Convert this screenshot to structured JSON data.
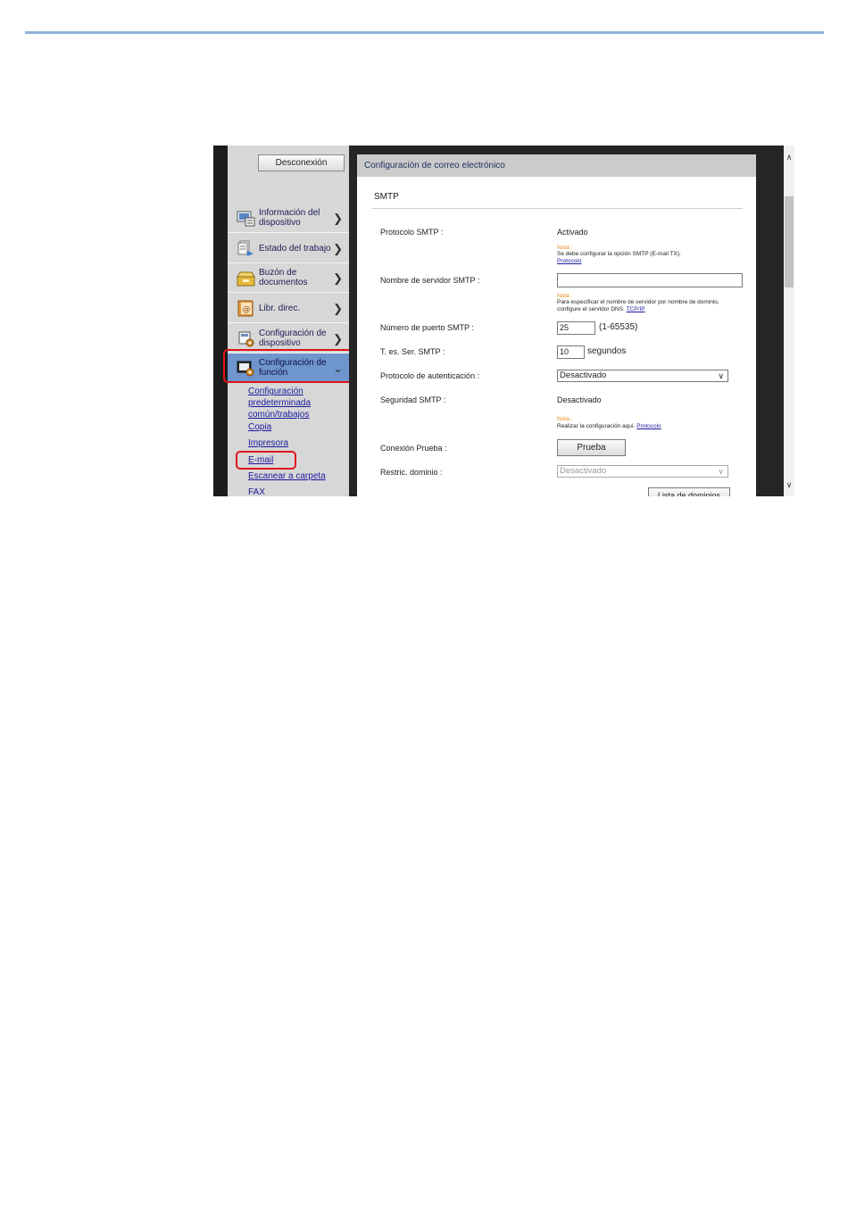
{
  "sidebar": {
    "logout_label": "Desconexión",
    "items": [
      {
        "label_l1": "Información del",
        "label_l2": "dispositivo"
      },
      {
        "label": "Estado del trabajo"
      },
      {
        "label_l1": "Buzón de",
        "label_l2": "documentos"
      },
      {
        "label": "Libr. direc."
      },
      {
        "label_l1": "Configuración de",
        "label_l2": "dispositivo"
      },
      {
        "label_l1": "Configuración de",
        "label_l2": "función"
      }
    ],
    "sublinks": [
      {
        "label_l1": "Configuración",
        "label_l2": "predeterminada",
        "label_l3": "común/trabajos"
      },
      {
        "label": "Copia"
      },
      {
        "label": "Impresora"
      },
      {
        "label": "E-mail"
      },
      {
        "label": "Escanear a carpeta"
      },
      {
        "label": "FAX"
      }
    ]
  },
  "panel": {
    "header": "Configuración de correo electrónico",
    "section_title": "SMTP",
    "smtp_protocol": {
      "label": "Protocolo SMTP :",
      "value": "Activado",
      "note_title": "Nota :",
      "note_text": "Se debe configurar la opción SMTP (E-mail TX).",
      "note_link": "Protocolo"
    },
    "smtp_server": {
      "label": "Nombre de servidor SMTP :",
      "value": "",
      "note_title": "Nota :",
      "note_text": "Para especificar el nombre de servidor por nombre de dominio, configure el servidor DNS.",
      "note_link": "TCP/IP"
    },
    "smtp_port": {
      "label": "Número de puerto SMTP :",
      "value": "25",
      "range": "(1-65535)"
    },
    "smtp_timeout": {
      "label": "T. es. Ser. SMTP :",
      "value": "10",
      "unit": "segundos"
    },
    "auth_protocol": {
      "label": "Protocolo de autenticación :",
      "value": "Desactivado"
    },
    "smtp_security": {
      "label": "Seguridad SMTP :",
      "value": "Desactivado",
      "note_title": "Nota :",
      "note_text": "Realizar la configuración aquí.",
      "note_link": "Protocolo"
    },
    "connection_test": {
      "label": "Conexión Prueba :",
      "button": "Prueba"
    },
    "domain_restriction": {
      "label": "Restric. dominio :",
      "value": "Desactivado"
    },
    "domain_list_button": "Lista de dominios"
  },
  "colors": {
    "highlight_box": "#e0131b",
    "active_nav": "#6e95cc",
    "link": "#1a1a9e",
    "note": "#e8891b",
    "top_rule": "#8fb4dd"
  }
}
